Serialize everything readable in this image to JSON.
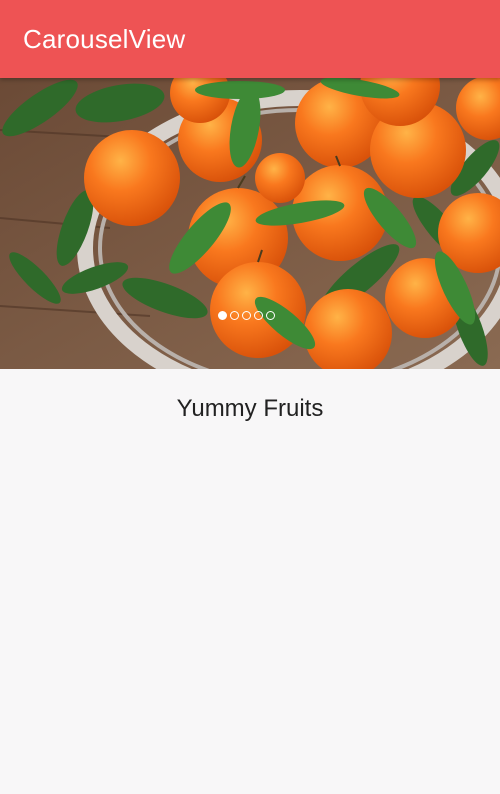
{
  "app_bar": {
    "title": "CarouselView",
    "color": "#ee5354"
  },
  "carousel": {
    "image_subject": "basket of mandarin oranges with leaves",
    "indicator_count": 5,
    "active_index": 0,
    "caption": "Yummy Fruits"
  }
}
